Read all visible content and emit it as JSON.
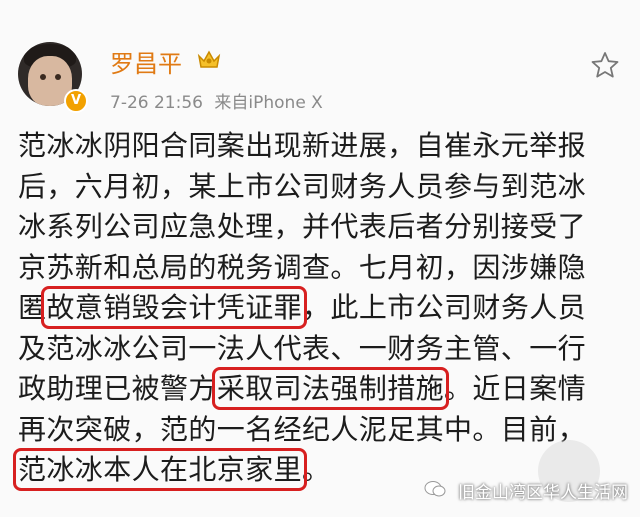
{
  "user": {
    "name": "罗昌平",
    "verified_mark": "V"
  },
  "meta": {
    "time": "7-26 21:56",
    "source": "来自iPhone X"
  },
  "post": {
    "lines": [
      [
        "范冰冰阴阳合同案出现新进展，自崔永元举报"
      ],
      [
        "后，六月初，某上市公司财务人员参与到范冰"
      ],
      [
        "冰系列公司应急处理，并代表后者分别接受了"
      ],
      [
        "京苏新和总局的税务调查。七月初，因涉嫌隐"
      ],
      [
        "匿",
        "故意销毁会计凭证罪",
        "，此上市公司财务人员"
      ],
      [
        "及范冰冰公司一法人代表、一财务主管、一行"
      ],
      [
        "政助理已被警方",
        "采取司法强制措施",
        "。近日案情"
      ],
      [
        "再次突破，范的一名经纪人泥足其中。目前，"
      ],
      [
        "范冰冰本人在北京家里",
        "。"
      ]
    ]
  },
  "watermark": "旧金山湾区华人生活网",
  "colors": {
    "username": "#e07a14",
    "highlight_box": "#d72020",
    "verified": "#f2a100"
  }
}
